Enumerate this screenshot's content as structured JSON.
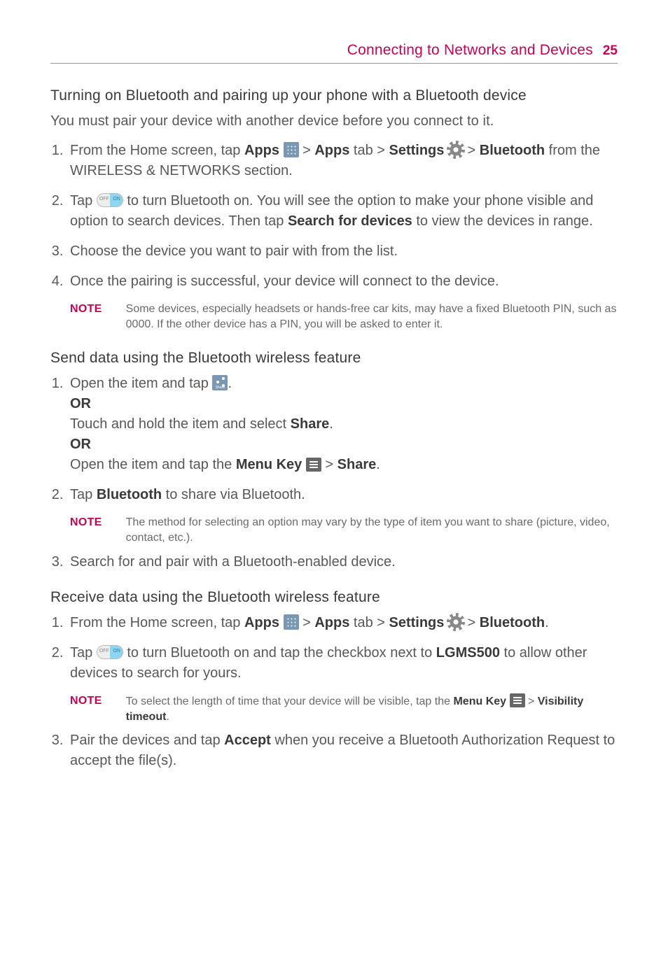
{
  "header": {
    "title": "Connecting to Networks and Devices",
    "page": "25"
  },
  "s1": {
    "title": "Turning on Bluetooth and pairing up your phone with a Bluetooth device",
    "intro": "You must pair your device with another device before you connect to it.",
    "step1_a": "From the Home screen, tap ",
    "apps": "Apps",
    "step1_b": " > ",
    "apps_tab": "Apps",
    "step1_c": " tab > ",
    "settings": "Settings",
    "step1_d": " > ",
    "bluetooth": "Bluetooth",
    "step1_e": " from the WIRELESS & NETWORKS section.",
    "step2_a": "Tap ",
    "step2_b": " to turn Bluetooth on. You will see the option to make your phone visible and option to search devices. Then tap ",
    "search_devices": "Search for devices",
    "step2_c": " to view the devices in range.",
    "step3": "Choose the device you want to pair with from the list.",
    "step4": "Once the pairing is successful, your device will connect to the device.",
    "note_label": "NOTE",
    "note": "Some devices, especially headsets or hands-free car kits, may have a fixed Bluetooth PIN, such as 0000. If the other device has a PIN, you will be asked to enter it."
  },
  "s2": {
    "title": "Send data using the Bluetooth wireless feature",
    "step1_a": "Open the item and tap ",
    "step1_b": ".",
    "or": "OR",
    "step1_c": "Touch and hold the item and select ",
    "share": "Share",
    "step1_d": ".",
    "step1_e": "Open the item and tap the ",
    "menu_key": "Menu Key",
    "step1_f": " > ",
    "step1_g": ".",
    "step2_a": "Tap ",
    "bluetooth": "Bluetooth",
    "step2_b": " to share via Bluetooth.",
    "note_label": "NOTE",
    "note": "The method for selecting an option may vary by the type of item you want to share (picture, video, contact, etc.).",
    "step3": "Search for and pair with a Bluetooth-enabled device."
  },
  "s3": {
    "title": "Receive data using the Bluetooth wireless feature",
    "step1_a": "From the Home screen, tap ",
    "apps": "Apps",
    "step1_b": " > ",
    "apps_tab": "Apps",
    "step1_c": " tab > ",
    "settings": "Settings",
    "step1_d": " > ",
    "bluetooth": "Bluetooth",
    "step1_e": ".",
    "step2_a": "Tap ",
    "step2_b": " to turn Bluetooth on and tap the checkbox next to ",
    "lgms500": "LGMS500",
    "step2_c": " to allow other devices to search for yours.",
    "note_label": "NOTE",
    "note_a": "To select the length of time that your device will be visible, tap the ",
    "menu_key": "Menu Key",
    "note_b": " > ",
    "vis_timeout": "Visibility timeout",
    "note_c": ".",
    "step3_a": "Pair the devices and tap ",
    "accept": "Accept",
    "step3_b": " when you receive a Bluetooth Authorization Request to accept the file(s)."
  }
}
